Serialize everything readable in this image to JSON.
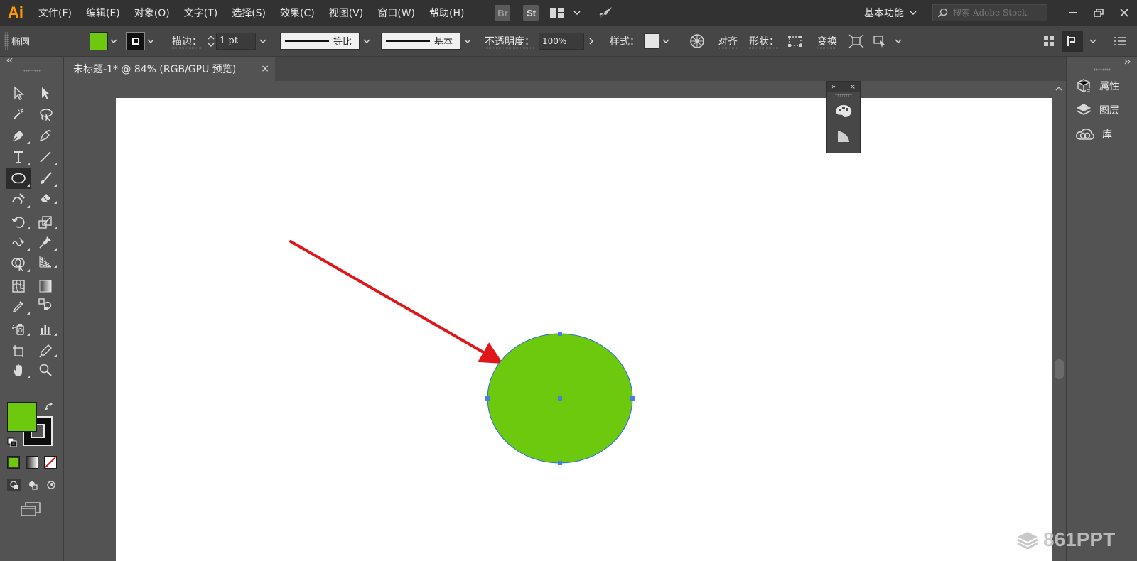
{
  "app": {
    "logo": "Ai"
  },
  "menu": {
    "items": [
      "文件(F)",
      "编辑(E)",
      "对象(O)",
      "文字(T)",
      "选择(S)",
      "效果(C)",
      "视图(V)",
      "窗口(W)",
      "帮助(H)"
    ],
    "badges": {
      "bridge": "Br",
      "stock": "St"
    },
    "workspace": "基本功能",
    "stock_search_placeholder": "搜索 Adobe Stock"
  },
  "control": {
    "tool_name": "椭圆",
    "stroke_label": "描边：",
    "stroke_weight": "1 pt",
    "profile_label": "等比",
    "brush_label": "基本",
    "opacity_label": "不透明度：",
    "opacity_value": "100%",
    "style_label": "样式：",
    "align_label": "对齐",
    "shape_label": "形状：",
    "transform_label": "变换"
  },
  "document": {
    "tab_title": "未标题-1* @ 84% (RGB/GPU 预览)",
    "tab_close": "×"
  },
  "right_panel": {
    "items": [
      {
        "label": "属性",
        "icon": "properties-icon"
      },
      {
        "label": "图层",
        "icon": "layers-icon"
      },
      {
        "label": "库",
        "icon": "libraries-icon"
      }
    ]
  },
  "float_panel": {
    "expand": "»",
    "close": "×"
  },
  "colors": {
    "fill": "#6dc90e",
    "stroke": "#000000",
    "arrow": "#e0161a",
    "selection": "#4a7fe0",
    "brand": "#ff9a00"
  },
  "watermark": "861PPT"
}
